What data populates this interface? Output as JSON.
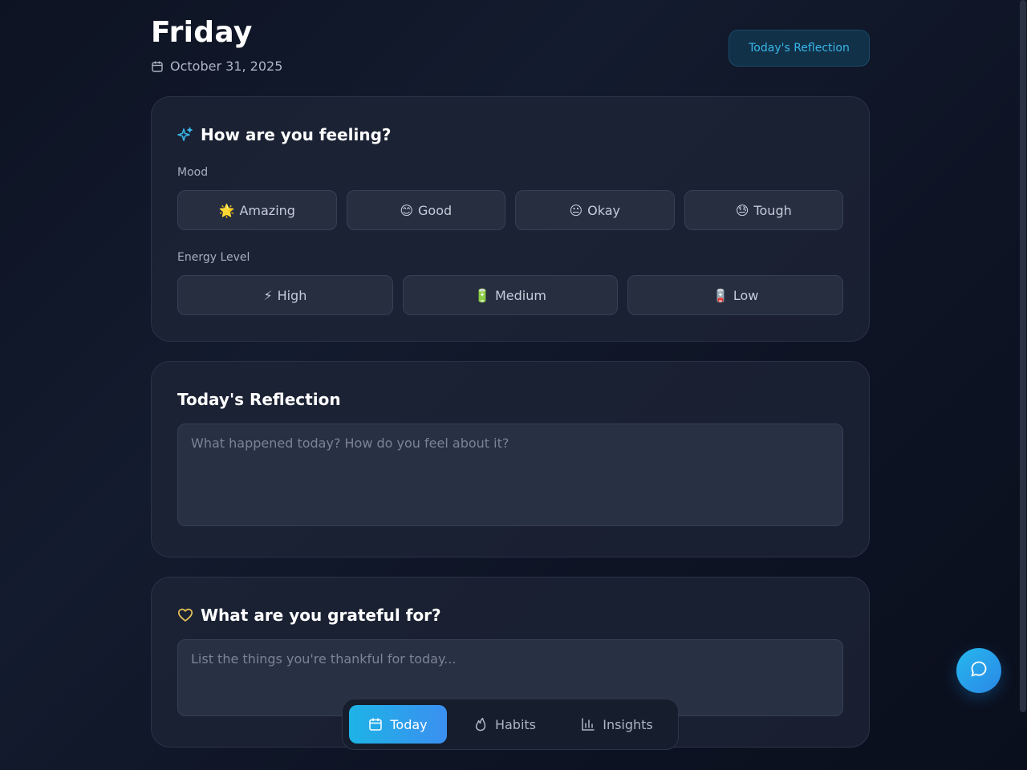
{
  "header": {
    "day": "Friday",
    "date": "October 31, 2025",
    "date_icon": "calendar-icon",
    "badge_label": "Today's Reflection"
  },
  "feeling_card": {
    "title": "How are you feeling?",
    "title_icon": "sparkles-icon",
    "mood_label": "Mood",
    "mood_options": [
      {
        "emoji": "🌟",
        "label": "Amazing"
      },
      {
        "emoji": "😊",
        "label": "Good"
      },
      {
        "emoji": "😐",
        "label": "Okay"
      },
      {
        "emoji": "😓",
        "label": "Tough"
      }
    ],
    "energy_label": "Energy Level",
    "energy_options": [
      {
        "emoji": "⚡",
        "label": "High"
      },
      {
        "emoji": "🔋",
        "label": "Medium"
      },
      {
        "emoji": "🪫",
        "label": "Low"
      }
    ]
  },
  "reflection_card": {
    "title": "Today's Reflection",
    "placeholder": "What happened today? How do you feel about it?"
  },
  "gratitude_card": {
    "title": "What are you grateful for?",
    "title_icon": "heart-icon",
    "placeholder": "List the things you're thankful for today..."
  },
  "bottom_nav": {
    "items": [
      {
        "label": "Today",
        "icon": "calendar-icon",
        "active": true
      },
      {
        "label": "Habits",
        "icon": "flame-icon",
        "active": false
      },
      {
        "label": "Insights",
        "icon": "bar-chart-icon",
        "active": false
      }
    ]
  },
  "chat_button": {
    "icon": "chat-bubble-icon"
  },
  "colors": {
    "accent": "#39b6e8",
    "accent_gradient_start": "#1eb3e6",
    "accent_gradient_end": "#3b8ff0",
    "heart": "#e8c25a"
  }
}
